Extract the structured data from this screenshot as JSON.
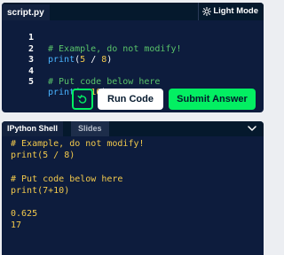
{
  "editor": {
    "file_tab": "script.py",
    "light_mode_label": "Light Mode",
    "lines": [
      {
        "number": "1",
        "text": "# Example, do not modify!"
      },
      {
        "number": "2",
        "text": "print(5 / 8)"
      },
      {
        "number": "3",
        "text": ""
      },
      {
        "number": "4",
        "text": "# Put code below here"
      },
      {
        "number": "5",
        "text": "print(7+10)"
      }
    ],
    "code_tokens": {
      "l1_comment": "# Example, do not modify!",
      "l2_fn": "print",
      "l2_open": "(",
      "l2_a": "5",
      "l2_op": " / ",
      "l2_b": "8",
      "l2_close": ")",
      "l4_comment": "# Put code below here",
      "l5_fn": "print",
      "l5_open": "(",
      "l5_a": "7",
      "l5_op": "+",
      "l5_b": "10",
      "l5_close": ")"
    },
    "run_label": "Run Code",
    "submit_label": "Submit Answer"
  },
  "shell": {
    "tabs": [
      {
        "label": "IPython Shell",
        "active": true
      },
      {
        "label": "Slides",
        "active": false
      }
    ],
    "output": [
      "# Example, do not modify!",
      "print(5 / 8)",
      "",
      "# Put code below here",
      "print(7+10)",
      "",
      "0.625",
      "17"
    ]
  },
  "colors": {
    "panel_bg": "#0d1c3d",
    "tabbar_bg": "#05192d",
    "accent_green": "#03ef62",
    "comment": "#59c36a",
    "function": "#49b3ff",
    "number": "#f2c94c",
    "shell_text": "#f2c94c"
  },
  "icons": {
    "light_mode": "sun-icon",
    "reset": "reset-icon",
    "collapse": "chevron-down-icon"
  }
}
